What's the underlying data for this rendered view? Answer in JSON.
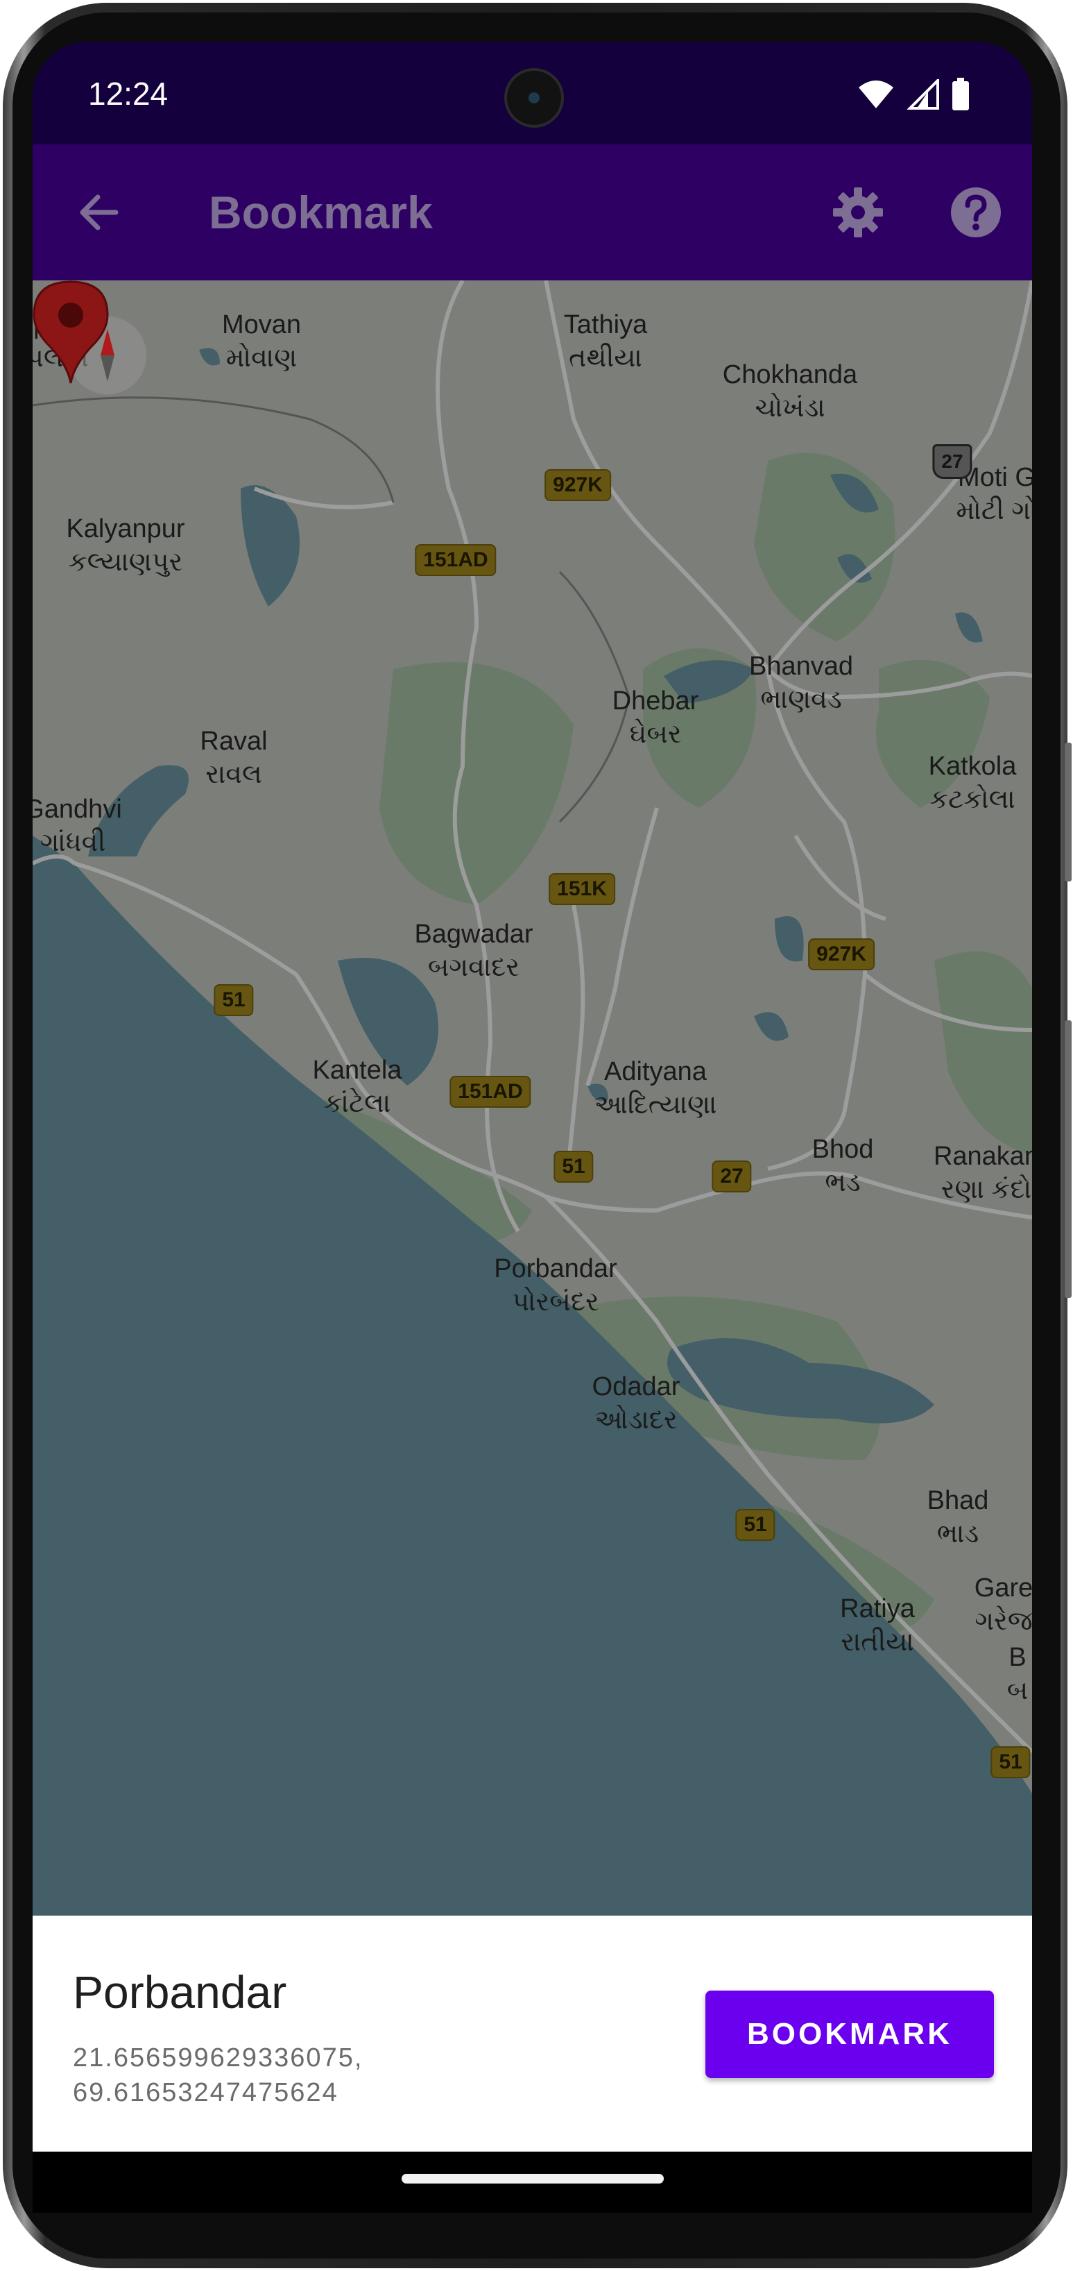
{
  "status_bar": {
    "time": "12:24"
  },
  "app_bar": {
    "title": "Bookmark",
    "back_icon": "arrow-back-icon",
    "settings_icon": "gear-icon",
    "help_icon": "help-circle-icon"
  },
  "map": {
    "places": [
      {
        "name": "Movan",
        "alt": "મોવાણ"
      },
      {
        "name": "Tathiya",
        "alt": "તથીયા"
      },
      {
        "name": "Chokhanda",
        "alt": "ચોખંડા"
      },
      {
        "name": "Moti G",
        "alt": "મોટી ગો"
      },
      {
        "name": "Kalyanpur",
        "alt": "કલ્યાણપુર"
      },
      {
        "name": "Bhanvad",
        "alt": "ભાણવડ"
      },
      {
        "name": "Raval",
        "alt": "રાવલ"
      },
      {
        "name": "Dhebar",
        "alt": "ઘેબર"
      },
      {
        "name": "Katkola",
        "alt": "કટકોલા"
      },
      {
        "name": "Gandhvi",
        "alt": "ગાંધવી"
      },
      {
        "name": "Bagwadar",
        "alt": "બગવાદર"
      },
      {
        "name": "Kantela",
        "alt": "કાંટેલા"
      },
      {
        "name": "Adityana",
        "alt": "આદિત્યાણા"
      },
      {
        "name": "Bhod",
        "alt": "ભડ"
      },
      {
        "name": "Ranakan",
        "alt": "રણા કંદો"
      },
      {
        "name": "Porbandar",
        "alt": "પોરબંદર"
      },
      {
        "name": "Odadar",
        "alt": "ઓડાદર"
      },
      {
        "name": "Bhad",
        "alt": "ભાડ"
      },
      {
        "name": "Ratiya",
        "alt": "રાતીયા"
      },
      {
        "name": "Gare",
        "alt": "ગરેજ"
      },
      {
        "name": "B",
        "alt": "બ"
      },
      {
        "name": "opalka",
        "alt": "પલકા"
      }
    ],
    "road_shields": [
      "927K",
      "151AD",
      "151K",
      "927K",
      "51",
      "151AD",
      "51",
      "27",
      "51",
      "51",
      "27"
    ]
  },
  "bottom_sheet": {
    "place_name": "Porbandar",
    "coordinates_line1": "21.656599629336075,",
    "coordinates_line2": "69.61653247475624",
    "bookmark_button": "BOOKMARK"
  },
  "colors": {
    "status_bar": "#14003d",
    "app_bar": "#2e0063",
    "button": "#6a00ee",
    "pin": "#8c1515"
  }
}
